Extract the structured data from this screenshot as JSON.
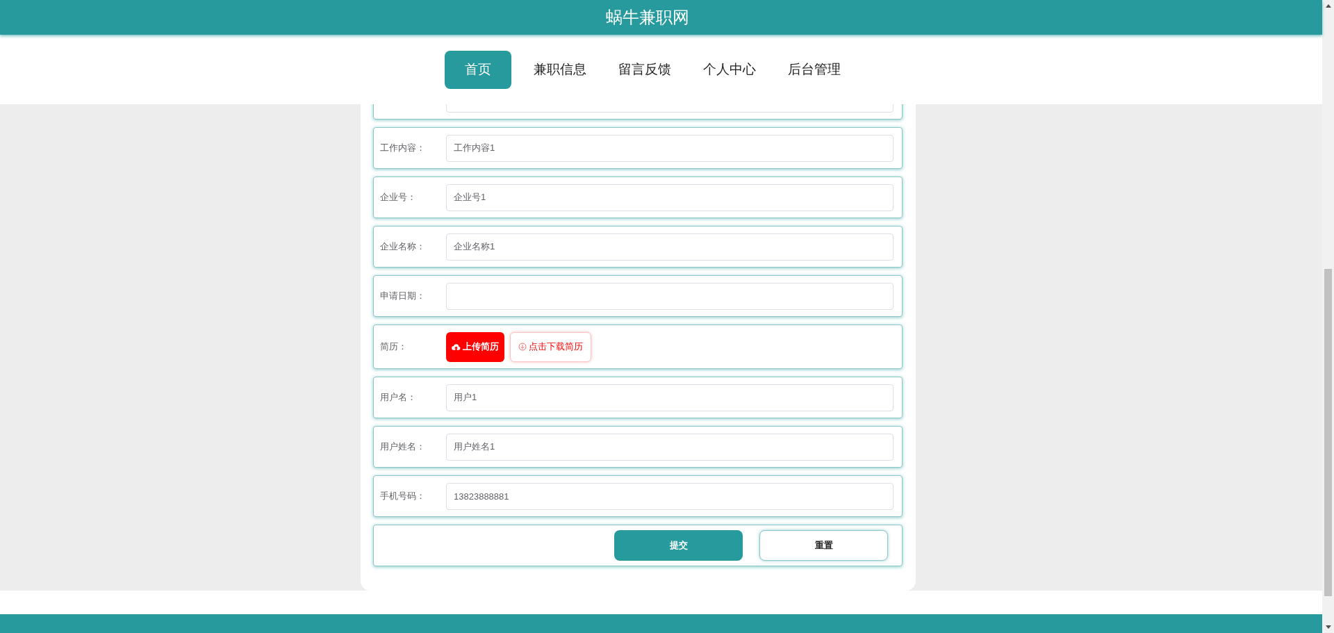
{
  "site_title": "蜗牛兼职网",
  "nav": [
    {
      "label": "首页",
      "selected": true
    },
    {
      "label": "兼职信息",
      "selected": false
    },
    {
      "label": "留言反馈",
      "selected": false
    },
    {
      "label": "个人中心",
      "selected": false
    },
    {
      "label": "后台管理",
      "selected": false
    }
  ],
  "form": {
    "rows": [
      {
        "kind": "field"
      },
      {
        "kind": "field",
        "label": "工作内容：",
        "value": "工作内容1"
      },
      {
        "kind": "field",
        "label": "企业号：",
        "value": "企业号1"
      },
      {
        "kind": "field",
        "label": "企业名称：",
        "value": "企业名称1"
      },
      {
        "kind": "field",
        "label": "申请日期："
      },
      {
        "kind": "file",
        "label": "简历：",
        "buttons": [
          {
            "kind": "upload",
            "label": "上传简历"
          },
          {
            "kind": "download",
            "label": "点击下载简历"
          }
        ]
      },
      {
        "kind": "field",
        "label": "用户名：",
        "value": "用户1"
      },
      {
        "kind": "field",
        "label": "用户姓名：",
        "value": "用户姓名1"
      },
      {
        "kind": "field",
        "label": "手机号码：",
        "value": "13823888881"
      }
    ],
    "actions": [
      {
        "kind": "primary",
        "label": "提交"
      },
      {
        "kind": "secondary",
        "label": "重置"
      }
    ]
  }
}
